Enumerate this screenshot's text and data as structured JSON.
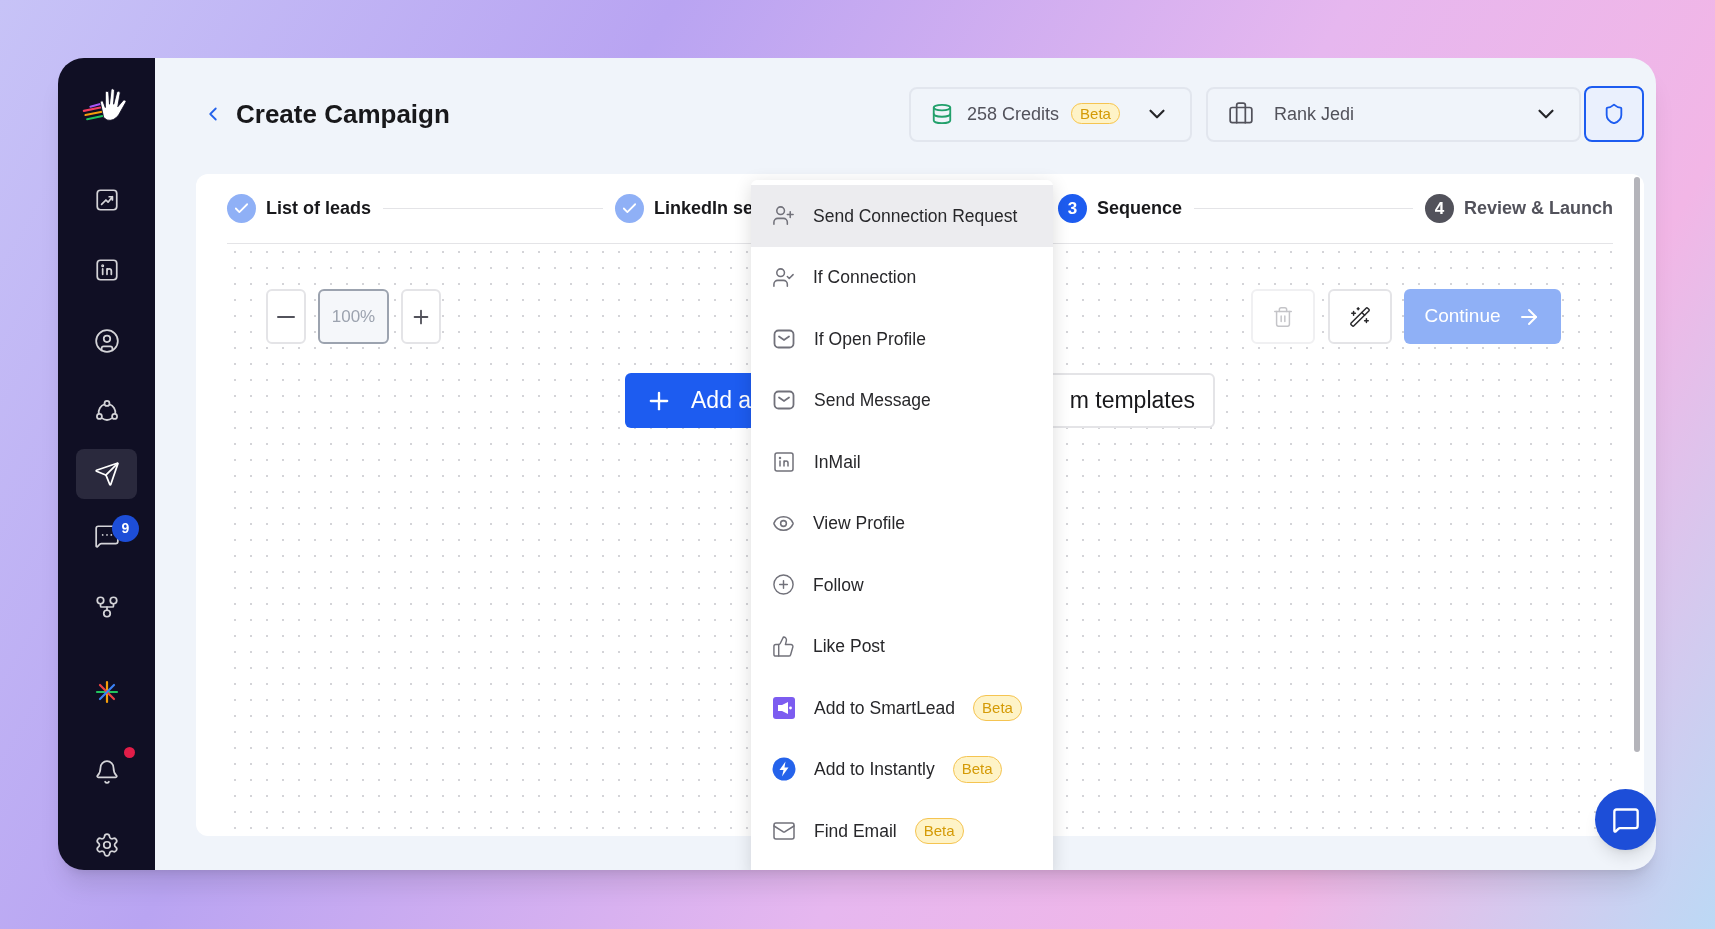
{
  "sidebar": {
    "items": [
      {
        "selected": false
      },
      {
        "selected": false
      },
      {
        "selected": false
      },
      {
        "selected": false
      },
      {
        "selected": true
      },
      {
        "selected": false,
        "badge": "9"
      },
      {
        "selected": false
      },
      {
        "selected": false
      },
      {
        "selected": false,
        "alert": true
      },
      {
        "selected": false
      }
    ]
  },
  "header": {
    "title": "Create Campaign",
    "credits": {
      "text": "258 Credits",
      "badge": "Beta"
    },
    "workspace": "Rank Jedi"
  },
  "steps": [
    {
      "label": "List of leads",
      "completed": true,
      "current": false
    },
    {
      "label": "LinkedIn se",
      "completed": true,
      "current": false
    },
    {
      "number": "3",
      "label": "Sequence",
      "completed": false,
      "current": true
    },
    {
      "number": "4",
      "label": "Review & Launch",
      "completed": false,
      "current": false
    }
  ],
  "canvas": {
    "zoom": "100%",
    "continue": {
      "label": "Continue",
      "disabled": true
    },
    "add_action": "Add a",
    "templates": "m templates"
  },
  "menu": {
    "items": [
      {
        "label": "Send Connection Request",
        "selected": true
      },
      {
        "label": "If Connection",
        "selected": false
      },
      {
        "label": "If Open Profile",
        "selected": false
      },
      {
        "label": "Send Message",
        "selected": false
      },
      {
        "label": "InMail",
        "selected": false
      },
      {
        "label": "View Profile",
        "selected": false
      },
      {
        "label": "Follow",
        "selected": false
      },
      {
        "label": "Like Post",
        "selected": false
      },
      {
        "label": "Add to SmartLead",
        "selected": false,
        "badge": "Beta"
      },
      {
        "label": "Add to Instantly",
        "selected": false,
        "badge": "Beta"
      },
      {
        "label": "Find Email",
        "selected": false,
        "badge": "Beta"
      }
    ]
  }
}
